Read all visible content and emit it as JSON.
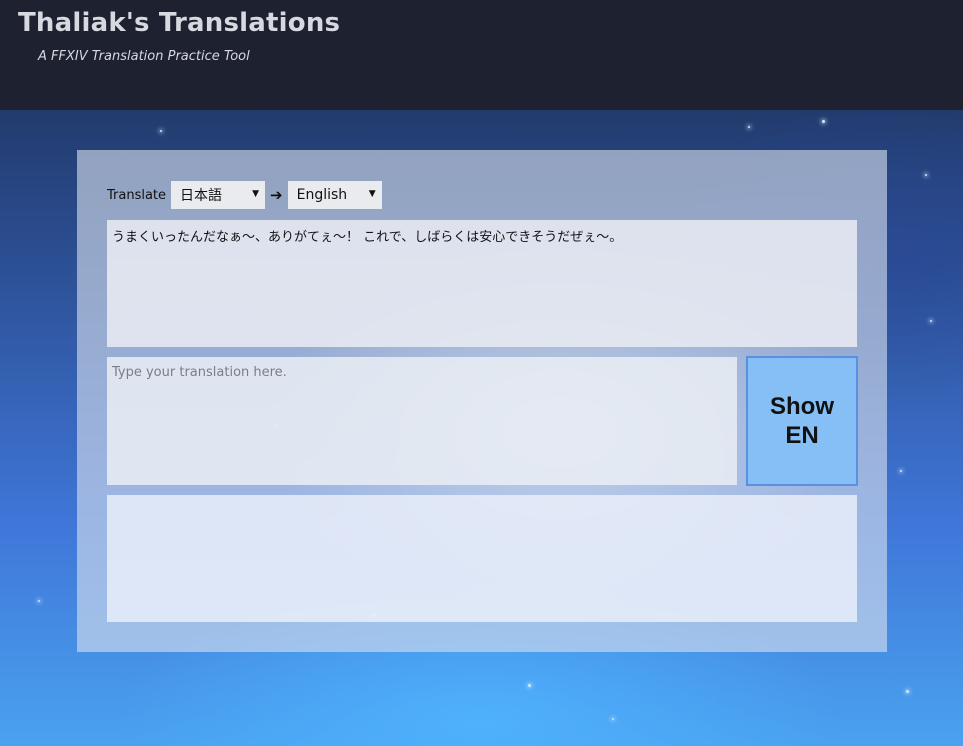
{
  "header": {
    "title": "Thaliak's Translations",
    "subtitle": "A FFXIV Translation Practice Tool"
  },
  "controls": {
    "translate_label": "Translate",
    "from_language": "日本語",
    "arrow": "➔",
    "to_language": "English"
  },
  "source": {
    "text": "うまくいったんだなぁ～、ありがてぇ～！ これで、しばらくは安心できそうだぜぇ～。"
  },
  "translation": {
    "placeholder": "Type your translation here.",
    "value": ""
  },
  "show_button": {
    "line1": "Show",
    "line2": "EN"
  },
  "result": {
    "text": ""
  },
  "colors": {
    "header_bg": "#1e2130",
    "button_bg": "#86bff5",
    "button_border": "#5b8fe0"
  }
}
